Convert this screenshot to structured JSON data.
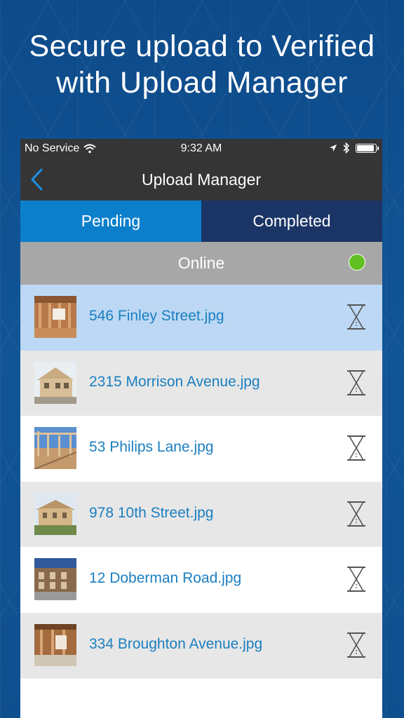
{
  "headline": {
    "line1": "Secure upload to Verified",
    "line2": "with Upload Manager"
  },
  "status_bar": {
    "carrier": "No Service",
    "time": "9:32 AM",
    "icons": [
      "wifi-icon",
      "location-arrow-icon",
      "bluetooth-icon",
      "battery-icon"
    ]
  },
  "navbar": {
    "title": "Upload Manager",
    "back_icon": "chevron-left-icon"
  },
  "tabs": [
    {
      "label": "Pending",
      "selected": true
    },
    {
      "label": "Completed",
      "selected": false
    }
  ],
  "connection": {
    "label": "Online",
    "indicator_color": "#62bf22"
  },
  "uploads": [
    {
      "filename": "546 Finley Street.jpg",
      "status_icon": "hourglass-icon",
      "highlighted": true
    },
    {
      "filename": "2315 Morrison Avenue.jpg",
      "status_icon": "hourglass-icon",
      "highlighted": false
    },
    {
      "filename": "53 Philips Lane.jpg",
      "status_icon": "hourglass-icon",
      "highlighted": false
    },
    {
      "filename": "978 10th Street.jpg",
      "status_icon": "hourglass-icon",
      "highlighted": false
    },
    {
      "filename": "12 Doberman Road.jpg",
      "status_icon": "hourglass-icon",
      "highlighted": false
    },
    {
      "filename": "334 Broughton Avenue.jpg",
      "status_icon": "hourglass-icon",
      "highlighted": false
    }
  ],
  "colors": {
    "background": "#0f4f8f",
    "bar": "#353535",
    "tab_active": "#0c7fcb",
    "tab_inactive": "#1b3566",
    "row_highlight": "#bcd8f4",
    "row_alt": "#e7e7e7",
    "row_plain": "#ffffff",
    "link_text": "#1b7fc0"
  }
}
